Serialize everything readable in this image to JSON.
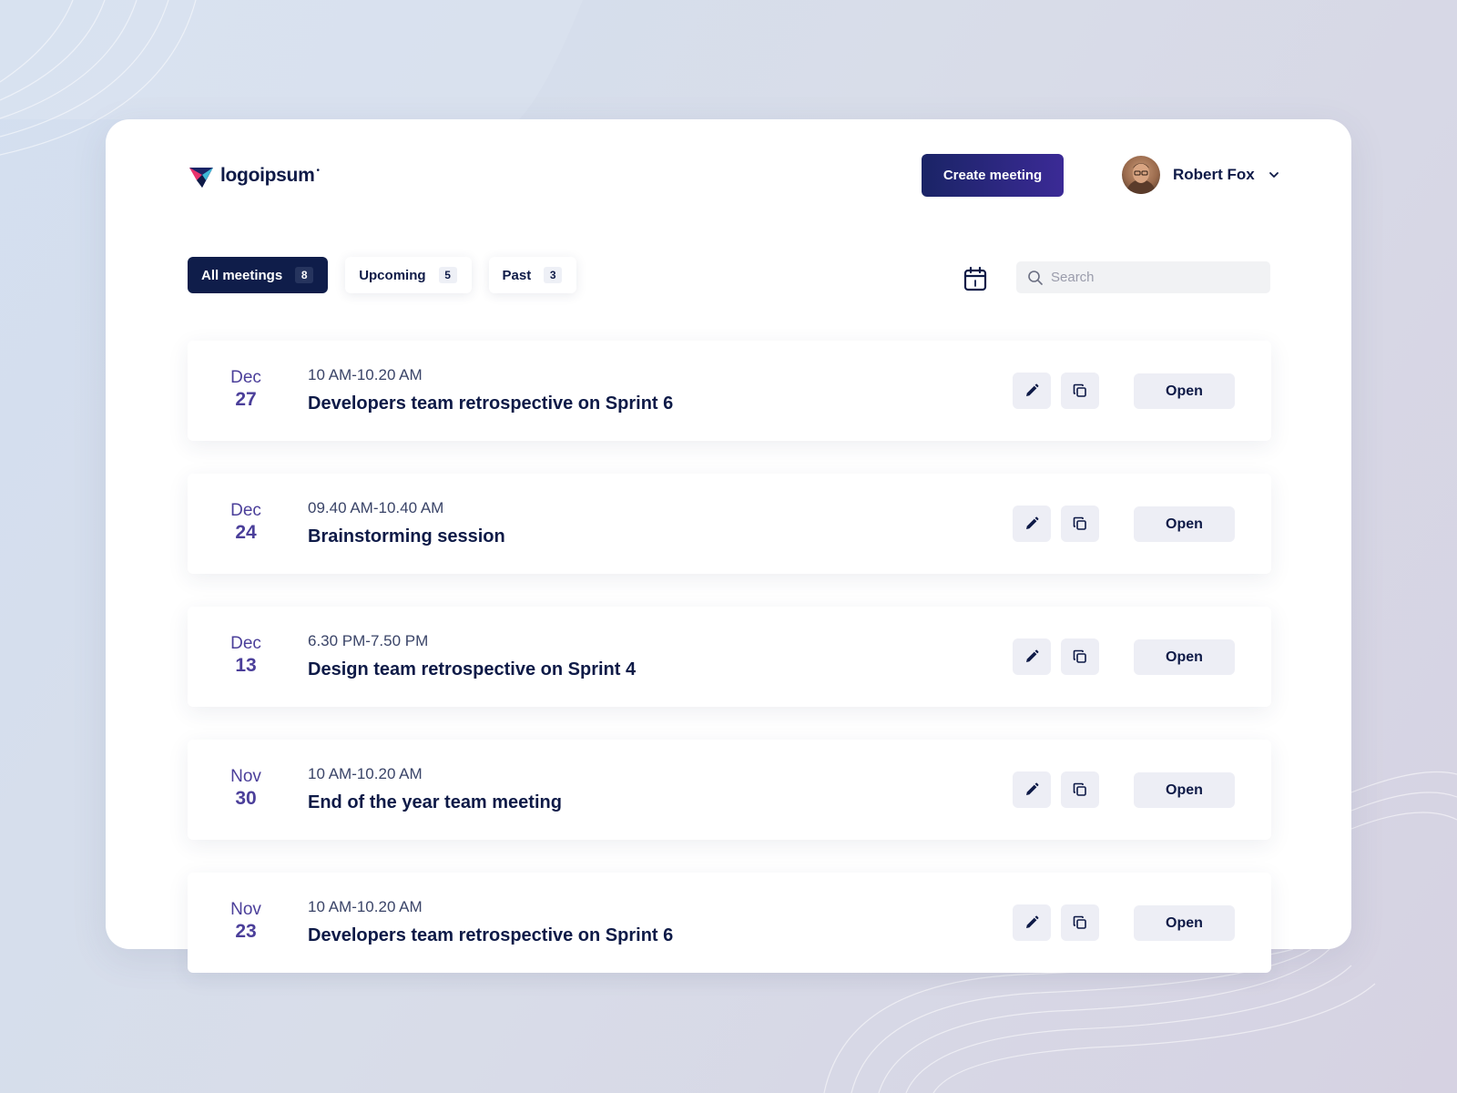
{
  "brand": {
    "name": "logoipsum",
    "mark": "•",
    "colors": {
      "accent": "#1a2466",
      "date": "#4b3f9a"
    }
  },
  "header": {
    "create_label": "Create meeting",
    "user_name": "Robert Fox",
    "icons": {
      "avatar": "avatar",
      "menu": "chevron-down-icon"
    }
  },
  "tabs": [
    {
      "label": "All meetings",
      "count": "8",
      "active": true
    },
    {
      "label": "Upcoming",
      "count": "5",
      "active": false
    },
    {
      "label": "Past",
      "count": "3",
      "active": false
    }
  ],
  "toolbar": {
    "calendar_icon": "calendar-icon",
    "search_placeholder": "Search",
    "search_value": ""
  },
  "meetings": [
    {
      "month": "Dec",
      "day": "27",
      "time": "10 AM-10.20 AM",
      "title": "Developers team retrospective on Sprint 6",
      "open_label": "Open"
    },
    {
      "month": "Dec",
      "day": "24",
      "time": "09.40 AM-10.40 AM",
      "title": "Brainstorming session",
      "open_label": "Open"
    },
    {
      "month": "Dec",
      "day": "13",
      "time": "6.30 PM-7.50 PM",
      "title": "Design team retrospective on Sprint 4",
      "open_label": "Open"
    },
    {
      "month": "Nov",
      "day": "30",
      "time": "10 AM-10.20 AM",
      "title": "End of the year team meeting",
      "open_label": "Open"
    },
    {
      "month": "Nov",
      "day": "23",
      "time": "10 AM-10.20 AM",
      "title": "Developers team retrospective on Sprint 6",
      "open_label": "Open"
    }
  ]
}
